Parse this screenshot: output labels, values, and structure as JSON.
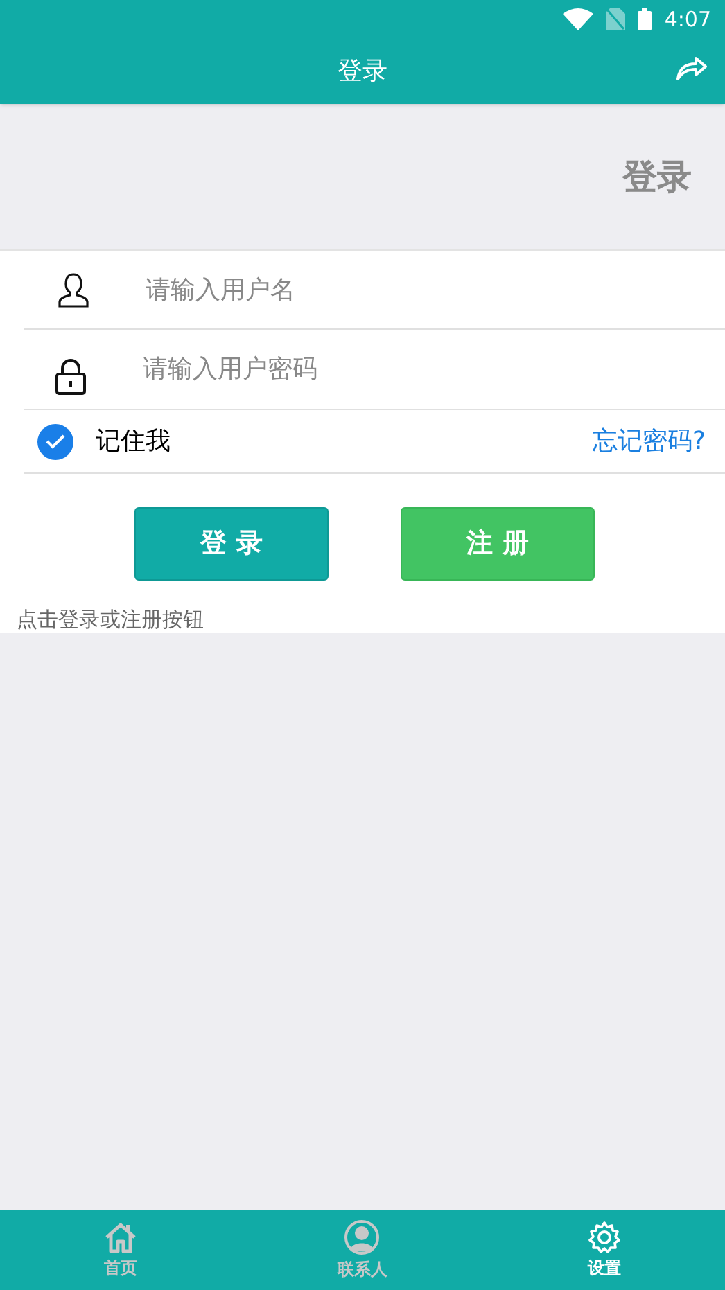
{
  "status_bar": {
    "time": "4:07"
  },
  "app_bar": {
    "title": "登录"
  },
  "banner": {
    "title": "登录"
  },
  "form": {
    "username": {
      "placeholder": "请输入用户名"
    },
    "password": {
      "placeholder": "请输入用户密码"
    },
    "remember": {
      "label": "记住我",
      "checked": true
    },
    "forgot_link": "忘记密码?",
    "buttons": [
      {
        "label": "登 录",
        "kind": "primary"
      },
      {
        "label": "注 册",
        "kind": "secondary"
      }
    ],
    "hint": "点击登录或注册按钮"
  },
  "bottom_nav": [
    {
      "label": "首页",
      "kind": "home",
      "selected": false
    },
    {
      "label": "联系人",
      "kind": "contacts",
      "selected": false
    },
    {
      "label": "设置",
      "kind": "settings",
      "selected": true
    }
  ]
}
